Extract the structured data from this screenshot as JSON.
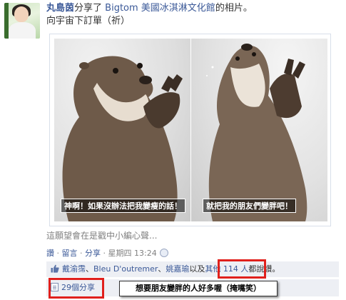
{
  "post": {
    "actor_name": "丸島茵",
    "action_text": "分享了",
    "page_name": "Bigtom 美國冰淇淋文化館",
    "object_text": "的相片。",
    "status_text": "向宇宙下訂單（祈）"
  },
  "photo": {
    "left_caption": "神啊！如果沒辦法把我變瘦的話！",
    "right_caption": "就把我的朋友們變胖吧！",
    "description": "這願望會在是戳中小編心聲..."
  },
  "actions": {
    "like": "讚",
    "separator": " · ",
    "comment": "留言",
    "share": "分享",
    "timestamp": "星期四 13:24",
    "privacy_icon": "globe-icon"
  },
  "likes": {
    "icon": "thumbs-up-icon",
    "person1": "戴渝霈",
    "comma": "、",
    "person2": "Bleu D'outremer",
    "person3": "姚嘉瑜",
    "and_text": "以及",
    "others_link": "其他 114 人",
    "suffix": "都說讚。"
  },
  "shares": {
    "icon": "share-icon",
    "label": "29個分享"
  },
  "annotation": {
    "callout_text": "想要朋友變胖的人好多喔（掩嘴笑）",
    "highlight_color": "#e0201c"
  },
  "colors": {
    "link": "#3b5998",
    "muted": "#808080",
    "bar_bg": "#edeff4"
  }
}
